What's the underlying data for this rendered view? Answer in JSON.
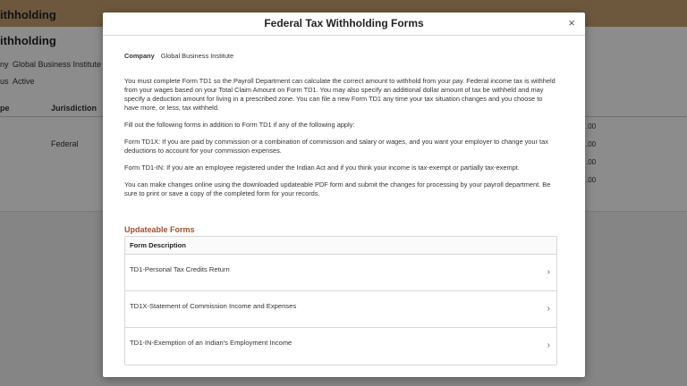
{
  "background": {
    "banner_title": "ithholding",
    "page_title": "ithholding",
    "company_label": "ny",
    "company_value": "Global Business Institute",
    "status_label": "us",
    "status_value": "Active",
    "table": {
      "col_type": "pe",
      "col_jurisdiction": "Jurisdiction",
      "federal": "Federal",
      "amounts": [
        ".00",
        ".00",
        ".00",
        ".00"
      ]
    }
  },
  "modal": {
    "title": "Federal Tax Withholding Forms",
    "close_glyph": "×",
    "company_label": "Company",
    "company_value": "Global Business Institute",
    "paragraphs": [
      "You must complete Form TD1 so the Payroll Department can calculate the correct amount to withhold from your pay. Federal income tax is withheld from your wages based on your Total Claim Amount on Form TD1. You may also specify an additional dollar amount of tax be withheld and may specify a deduction amount for living in a prescribed zone. You can file a new Form TD1 any time your tax situation changes and you choose to have more, or less, tax withheld.",
      "Fill out the following forms in addition to Form TD1 if any of the following apply:",
      "Form TD1X: If you are paid by commission or a combination of commission and salary or wages, and you want your employer to change your tax deductions to account for your commission expenses.",
      "Form TD1-IN: If you are an employee registered under the Indian Act and if you think your income is tax-exempt or partially tax-exempt.",
      "You can make changes online using the downloaded updateable PDF form and submit the changes for processing by your payroll department. Be sure to print or save a copy of the completed form for your records."
    ],
    "section_title": "Updateable Forms",
    "table_header": "Form Description",
    "forms": [
      "TD1-Personal Tax Credits Return",
      "TD1X-Statement of Commission Income and Expenses",
      "TD1-IN-Exemption of an Indian's Employment Income"
    ],
    "chevron_glyph": "›"
  },
  "colors": {
    "section_title": "#a0522d",
    "overlay": "#000000"
  }
}
